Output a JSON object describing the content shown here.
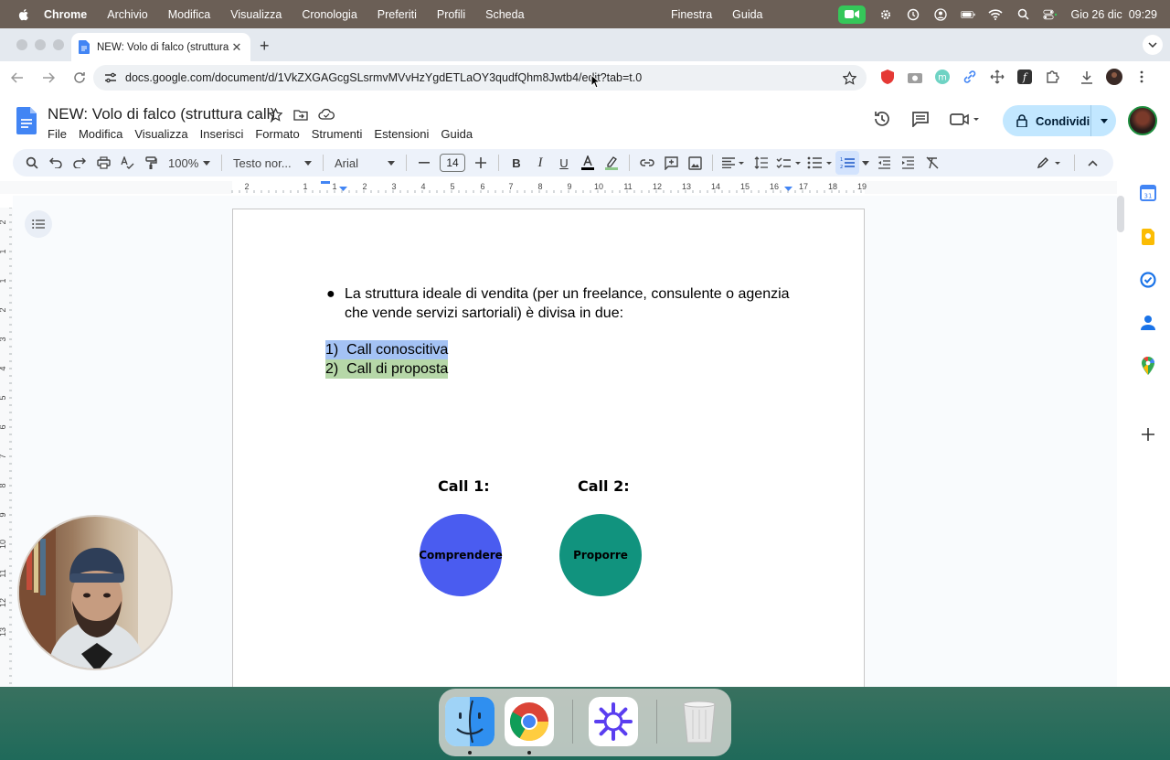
{
  "menubar": {
    "app_name": "Chrome",
    "items": [
      "Archivio",
      "Modifica",
      "Visualizza",
      "Cronologia",
      "Preferiti",
      "Profili",
      "Scheda"
    ],
    "center_items": [
      "Finestra",
      "Guida"
    ],
    "datetime": "Gio 26 dic  09:29"
  },
  "browser": {
    "tab_title": "NEW: Volo di falco (struttura call)",
    "url": "docs.google.com/document/d/1VkZXGAGcgSLsrmvMVvHzYgdETLaOY3qudfQhm8Jwtb4/edit?tab=t.0"
  },
  "docs": {
    "title": "NEW: Volo di falco (struttura call)",
    "menu": [
      "File",
      "Modifica",
      "Visualizza",
      "Inserisci",
      "Formato",
      "Strumenti",
      "Estensioni",
      "Guida"
    ],
    "share_label": "Condividi",
    "zoom": "100%",
    "style": "Testo nor...",
    "font": "Arial",
    "font_size": "14",
    "ruler_numbers": [
      "2",
      "1",
      "1",
      "2",
      "3",
      "4",
      "5",
      "6",
      "7",
      "8",
      "9",
      "10",
      "11",
      "12",
      "13",
      "14",
      "15",
      "16",
      "17",
      "18",
      "19"
    ],
    "vruler_numbers": [
      "2",
      "1",
      "1",
      "2",
      "3",
      "4",
      "5",
      "6",
      "7",
      "8",
      "9",
      "10",
      "11",
      "12",
      "13"
    ]
  },
  "document": {
    "bullet_text": "La struttura ideale di vendita (per un freelance, consulente o agenzia che vende servizi sartoriali) è divisa in due:",
    "bullet_char": "●",
    "items": [
      {
        "num": "1)",
        "text": "Call conoscitiva",
        "highlight": "#a4c2f4"
      },
      {
        "num": "2)",
        "text": "Call di proposta",
        "highlight": "#b6d7a8"
      }
    ],
    "calls": [
      {
        "label": "Call 1:",
        "circle_text": "Comprendere",
        "color": "#4a5cf0"
      },
      {
        "label": "Call 2:",
        "circle_text": "Proporre",
        "color": "#11937e"
      }
    ]
  },
  "colors": {
    "docs_blue": "#4285f4",
    "share_bg": "#c2e7ff",
    "facetime_green": "#35c759"
  }
}
